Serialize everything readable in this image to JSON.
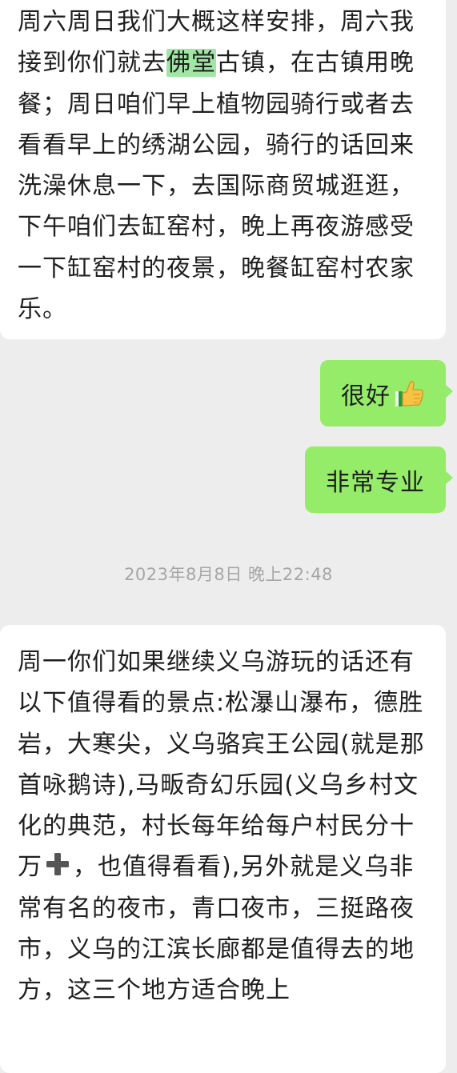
{
  "messages": {
    "first": {
      "before": "周六周日我们大概这样安排，周六我接到你们就去",
      "highlight": "佛堂",
      "after": "古镇，在古镇用晚餐；周日咱们早上植物园骑行或者去看看早上的绣湖公园，骑行的话回来洗澡休息一下，去国际商贸城逛逛，下午咱们去缸窑村，晚上再夜游感受一下缸窑村的夜景，晚餐缸窑村农家乐。"
    },
    "reply_good": "很好",
    "reply_pro": "非常专业",
    "timestamp": "2023年8月8日 晚上22:48",
    "third": {
      "part1": "周一你们如果继续义乌游玩的话还有以下值得看的景点:松瀑山瀑布，德胜岩，大寒尖，义乌骆宾王公园(就是那首咏鹅诗),马畈奇幻乐园(义乌乡村文化的典范，村长每年给每户村民分十万",
      "part2": "，也值得看看),另外就是义乌非常有名的夜市，青口夜市，三挺路夜市，义乌的江滨长廊都是值得去的地方，这三个地方适合晚上"
    }
  },
  "icons": {
    "thumbs_up": "thumbs-up-icon",
    "plus": "heavy-plus-icon"
  },
  "colors": {
    "background": "#ededed",
    "incoming_bubble": "#ffffff",
    "outgoing_bubble": "#95ec69",
    "highlight": "#a0e7a5",
    "timestamp_text": "#a6a6a6"
  }
}
